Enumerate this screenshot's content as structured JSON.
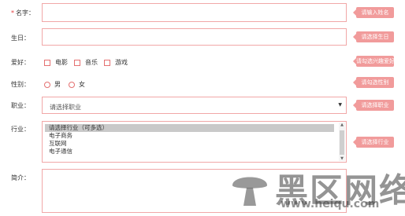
{
  "form": {
    "name": {
      "required_mark": "*",
      "label": "名字：",
      "value": "",
      "tip": "请输入姓名"
    },
    "birthday": {
      "label": "生日：",
      "value": "",
      "tip": "请选择生日"
    },
    "hobby": {
      "label": "爱好：",
      "options": [
        "电影",
        "音乐",
        "游戏"
      ],
      "tip": "请勾选兴趣爱好"
    },
    "gender": {
      "label": "性别：",
      "options": [
        "男",
        "女"
      ],
      "tip": "请勾选性别"
    },
    "occupation": {
      "label": "职业：",
      "selected": "请选择职业",
      "tip": "请选择职业"
    },
    "industry": {
      "label": "行业：",
      "items": [
        "请选择行业（可多选）",
        "电子商务",
        "互联网",
        "电子通信"
      ],
      "selected_index": 0,
      "tip": "请选择行业"
    },
    "intro": {
      "label": "简介：",
      "value": ""
    }
  },
  "icons": {
    "checkbox": "checkbox-icon",
    "radio": "radio-icon",
    "dropdown": "caret-down-icon",
    "watermark_logo": "mushroom-logo"
  },
  "colors": {
    "border": "#f1a7a7",
    "tip_bg": "#f19b9b",
    "required": "#e4393c"
  },
  "watermark": {
    "text": "黑区网络",
    "url": "www.heiqu.com"
  }
}
